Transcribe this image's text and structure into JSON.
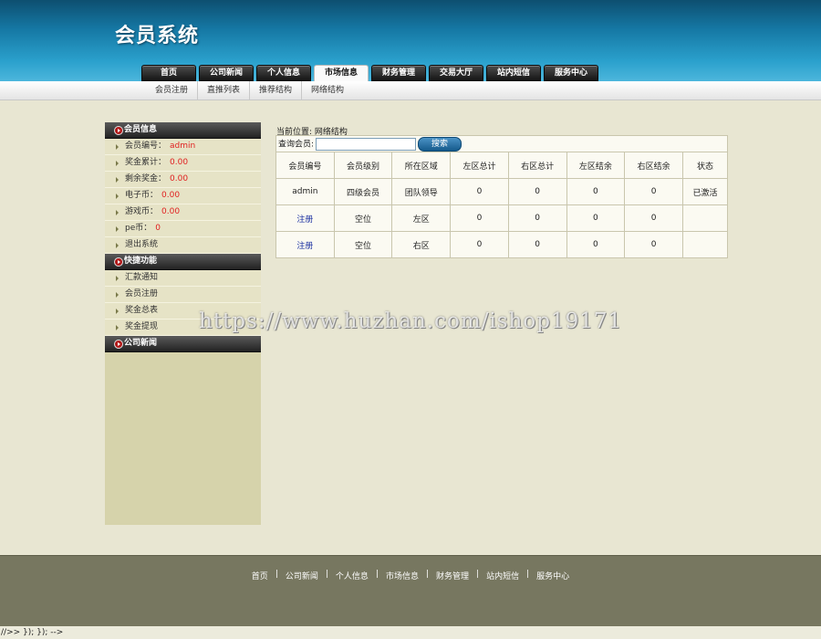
{
  "header": {
    "logo": "会员系统",
    "nav": [
      {
        "label": "首页",
        "active": false
      },
      {
        "label": "公司新闻",
        "active": false
      },
      {
        "label": "个人信息",
        "active": false
      },
      {
        "label": "市场信息",
        "active": true
      },
      {
        "label": "财务管理",
        "active": false
      },
      {
        "label": "交易大厅",
        "active": false
      },
      {
        "label": "站内短信",
        "active": false
      },
      {
        "label": "服务中心",
        "active": false
      }
    ],
    "subnav": [
      "会员注册",
      "直推列表",
      "推荐结构",
      "网络结构"
    ]
  },
  "sidebar": {
    "sections": [
      {
        "title": "会员信息",
        "items": [
          {
            "label": "会员编号：",
            "value": "admin"
          },
          {
            "label": "奖金累计：",
            "value": "0.00"
          },
          {
            "label": "剩余奖金：",
            "value": "0.00"
          },
          {
            "label": "电子币：",
            "value": "0.00"
          },
          {
            "label": "游戏币：",
            "value": "0.00"
          },
          {
            "label": "pe币：",
            "value": "0"
          },
          {
            "label": "退出系统",
            "value": ""
          }
        ]
      },
      {
        "title": "快捷功能",
        "items": [
          {
            "label": "汇款通知"
          },
          {
            "label": "会员注册"
          },
          {
            "label": "奖金总表"
          },
          {
            "label": "奖金提现"
          }
        ]
      },
      {
        "title": "公司新闻",
        "items": []
      }
    ]
  },
  "content": {
    "breadcrumb": "当前位置: 网络结构",
    "search": {
      "label": "查询会员:",
      "value": "",
      "placeholder": "",
      "button": "搜索"
    },
    "table": {
      "headers": [
        "会员编号",
        "会员级别",
        "所在区域",
        "左区总计",
        "右区总计",
        "左区结余",
        "右区结余",
        "状态"
      ],
      "rows": [
        [
          "admin",
          "四级会员",
          "团队领导",
          "0",
          "0",
          "0",
          "0",
          "已激活"
        ],
        [
          "注册",
          "空位",
          "左区",
          "0",
          "0",
          "0",
          "0",
          ""
        ],
        [
          "注册",
          "空位",
          "右区",
          "0",
          "0",
          "0",
          "0",
          ""
        ]
      ]
    }
  },
  "watermark": "https://www.huzhan.com/ishop19171",
  "footer": {
    "links": [
      "首页",
      "公司新闻",
      "个人信息",
      "市场信息",
      "财务管理",
      "站内短信",
      "服务中心"
    ],
    "separator": "|"
  },
  "bottom_text": "//>> }); }); -->",
  "colors": {
    "header_blue": "#1577a3",
    "page_bg": "#e8e6d2",
    "sidebar_bg": "#d6d3ab",
    "value_red": "#e02020",
    "link_blue": "#1a2fa0",
    "footer_bg": "#777760"
  }
}
